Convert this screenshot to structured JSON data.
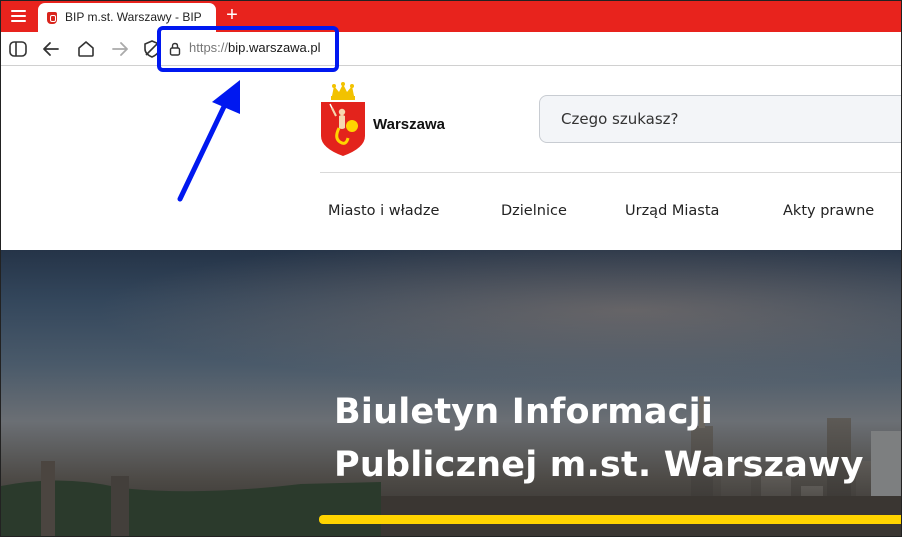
{
  "browser": {
    "tab_title": "BIP m.st. Warszawy - BIP",
    "new_tab_label": "+",
    "url_scheme": "https://",
    "url_host": "bip.warszawa.pl",
    "toolbar_icons": [
      "sidebar-icon",
      "back-icon",
      "home-icon",
      "forward-icon",
      "shield-icon"
    ]
  },
  "header": {
    "brand_name": "Warszawa",
    "search_placeholder": "Czego szukasz?"
  },
  "nav": {
    "items": [
      "Miasto i władze",
      "Dzielnice",
      "Urząd Miasta",
      "Akty prawne"
    ]
  },
  "hero": {
    "title_line1": "Biuletyn Informacji",
    "title_line2": "Publicznej m.st. Warszawy"
  },
  "colors": {
    "tabbar": "#e8231d",
    "highlight": "#0018f0",
    "accent_bar": "#ffd400"
  }
}
